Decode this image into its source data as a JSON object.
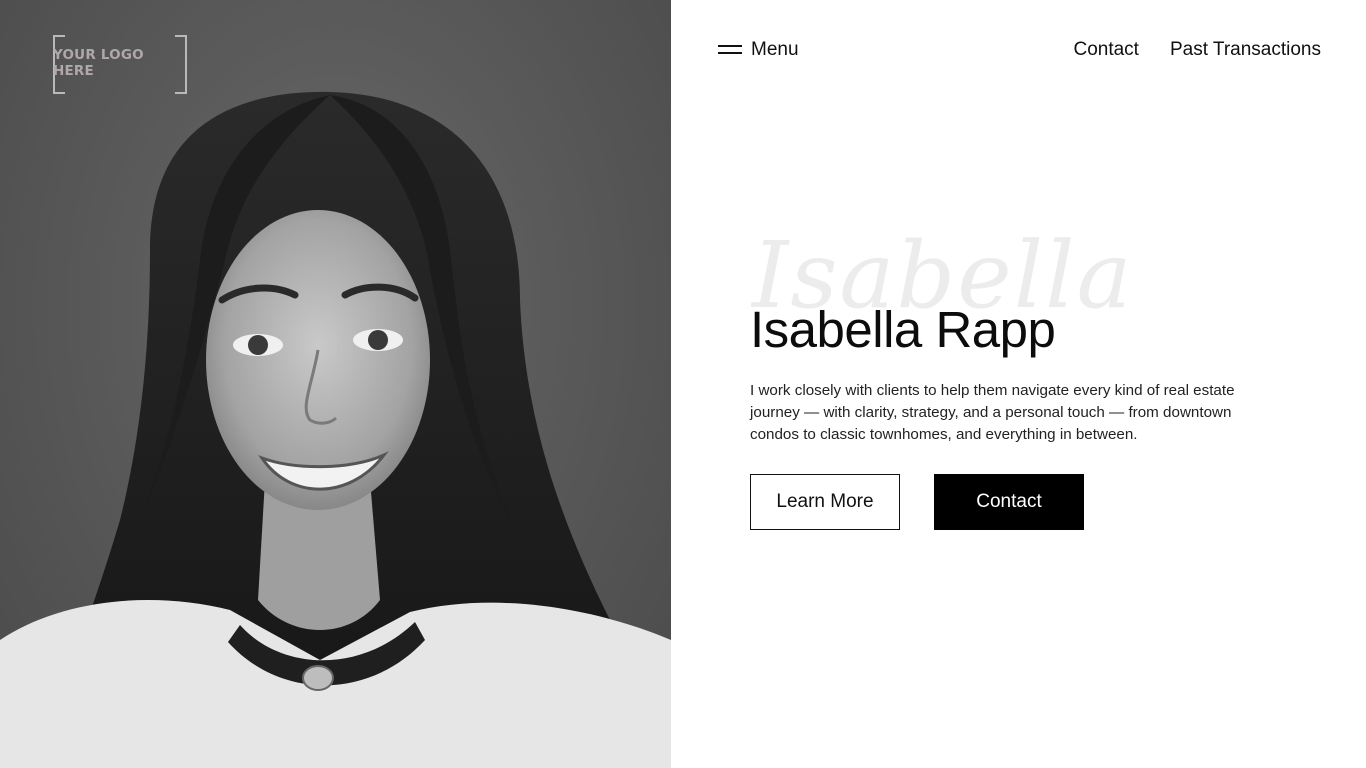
{
  "logo": {
    "text": "YOUR LOGO HERE"
  },
  "nav": {
    "menu_label": "Menu",
    "links": [
      "Contact",
      "Past Transactions"
    ]
  },
  "hero": {
    "script_name": "Isabella",
    "name": "Isabella Rapp",
    "bio": "I work closely with clients to help them navigate every kind of real estate journey — with clarity, strategy, and a personal touch — from downtown condos to classic townhomes, and everything in between.",
    "learn_more_label": "Learn More",
    "contact_label": "Contact"
  },
  "colors": {
    "photo_bg": "#5a5a5a",
    "primary_button": "#000000",
    "text": "#111111"
  }
}
